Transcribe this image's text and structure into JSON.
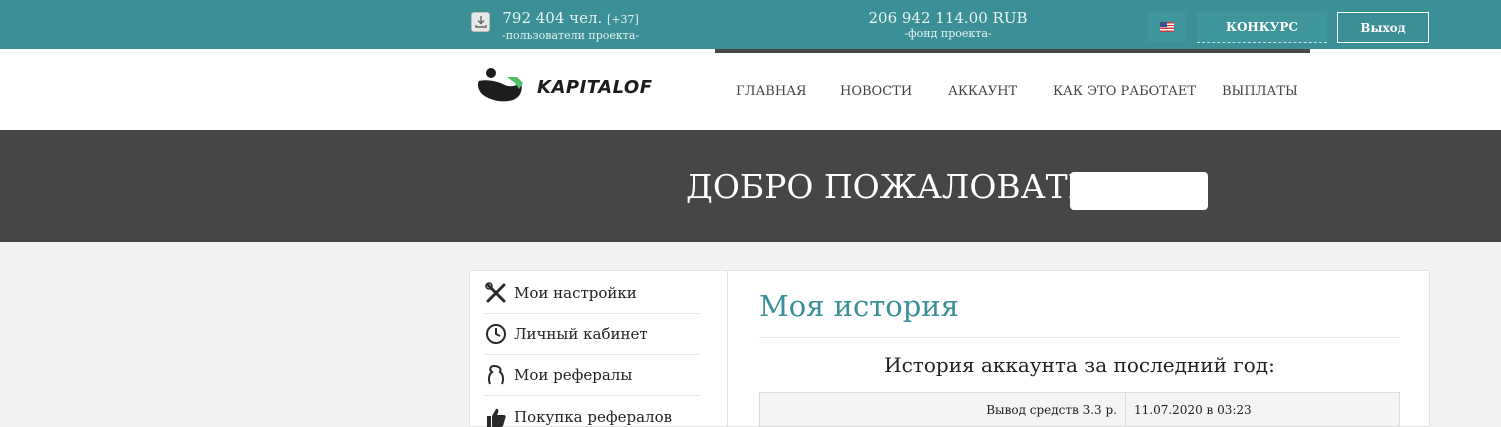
{
  "topbar": {
    "users_count": "792 404 чел.",
    "users_new": "[+37]",
    "users_label": "-пользователи проекта-",
    "fund_amount": "206 942 114.00 RUB",
    "fund_label": "-фонд проекта-",
    "language_flag": "us-flag-icon",
    "contest_label": "КОНКУРС",
    "logout_label": "Выход"
  },
  "logo": {
    "text": "KAPITALOF"
  },
  "nav": {
    "items": [
      "ГЛАВНАЯ",
      "НОВОСТИ",
      "АККАУНТ",
      "КАК ЭТО РАБОТАЕТ",
      "ВЫПЛАТЫ"
    ]
  },
  "hero": {
    "welcome": "ДОБРО ПОЖАЛОВАТЬ,"
  },
  "sidebar": {
    "items": [
      {
        "label": "Мои настройки",
        "icon": "tools-icon"
      },
      {
        "label": "Личный кабинет",
        "icon": "clock-icon"
      },
      {
        "label": "Мои рефералы",
        "icon": "referrals-icon"
      },
      {
        "label": "Покупка рефералов",
        "icon": "thumbs-up-icon"
      }
    ]
  },
  "main": {
    "title": "Моя история",
    "caption": "История аккаунта за последний год:",
    "rows": [
      {
        "description": "Вывод средств 3.3 р.",
        "date": "11.07.2020 в 03:23"
      }
    ]
  },
  "colors": {
    "accent": "#3b8f96",
    "hero_bg": "#464646",
    "page_bg": "#f2f2f2"
  }
}
